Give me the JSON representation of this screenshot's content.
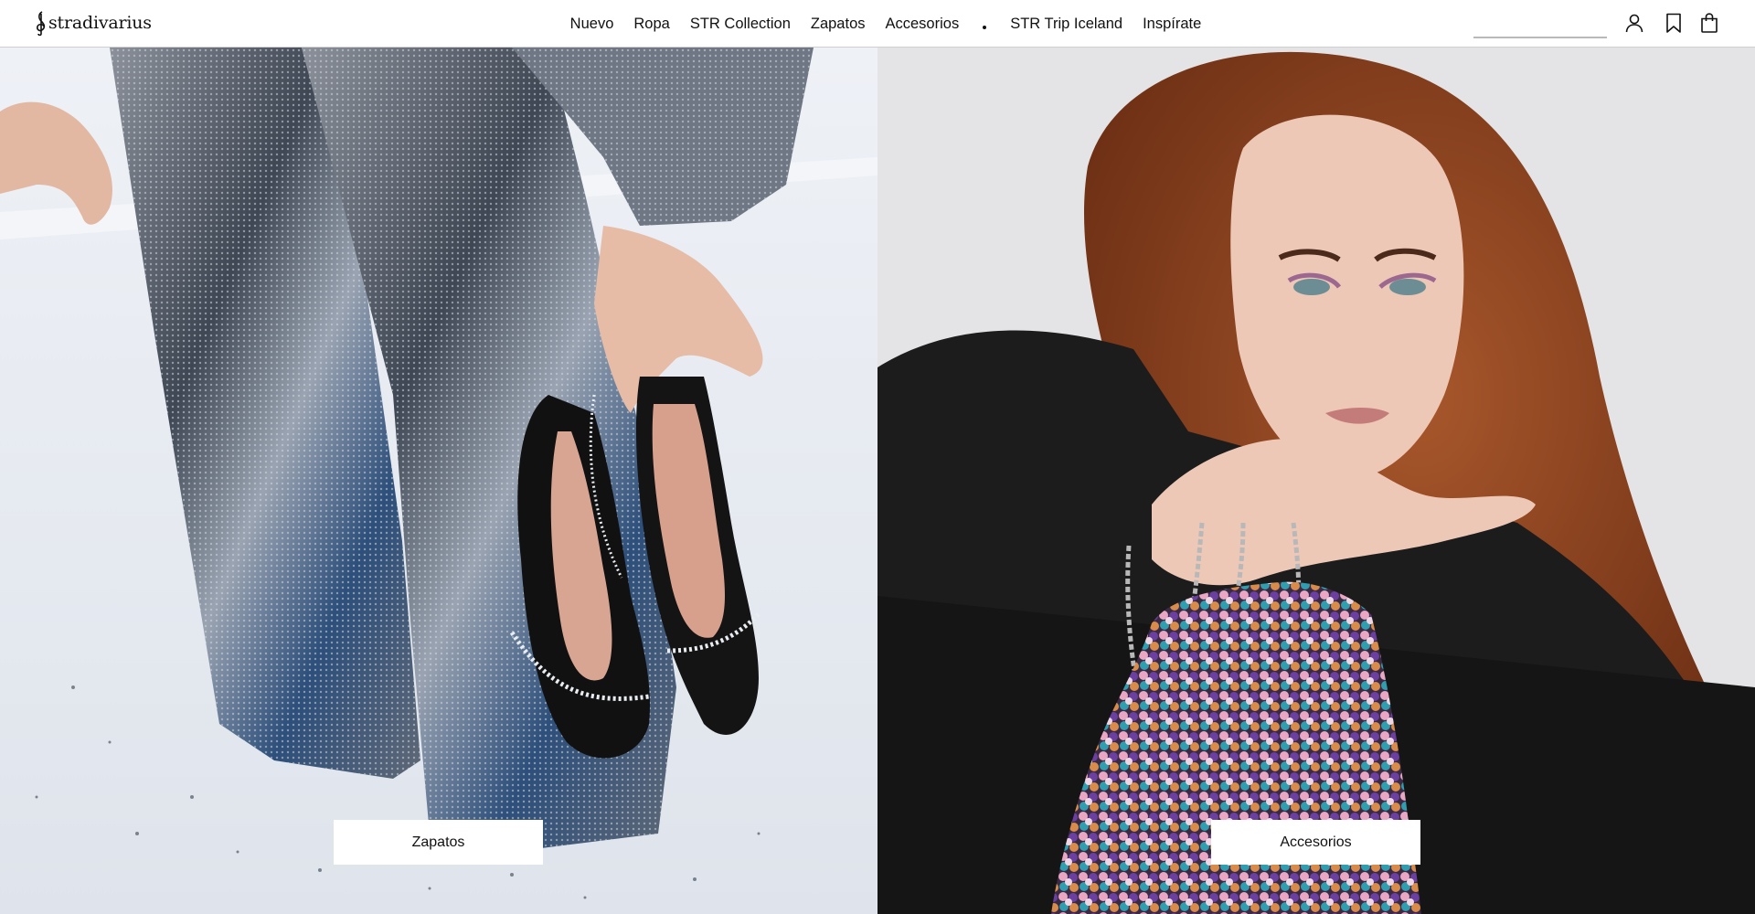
{
  "brand": {
    "name": "stradivarius",
    "logo_icon": "treble-clef-icon"
  },
  "nav": {
    "items": [
      {
        "label": "Nuevo"
      },
      {
        "label": "Ropa"
      },
      {
        "label": "STR Collection"
      },
      {
        "label": "Zapatos"
      },
      {
        "label": "Accesorios"
      },
      {
        "label": "STR Trip Iceland"
      },
      {
        "label": "Inspírate"
      }
    ]
  },
  "header": {
    "search": {
      "placeholder": "",
      "value": "",
      "icon": "search-icon"
    },
    "icons": [
      "user-icon",
      "bookmark-icon",
      "shopping-bag-icon"
    ]
  },
  "hero": {
    "left": {
      "cta_label": "Zapatos",
      "image": "woman-in-sequin-suit-holding-black-strappy-sandals"
    },
    "right": {
      "cta_label": "Accesorios",
      "image": "red-haired-model-with-sequin-drawstring-bag"
    }
  },
  "colors": {
    "background": "#ffffff",
    "text": "#111111",
    "divider": "#cfcfcf"
  }
}
